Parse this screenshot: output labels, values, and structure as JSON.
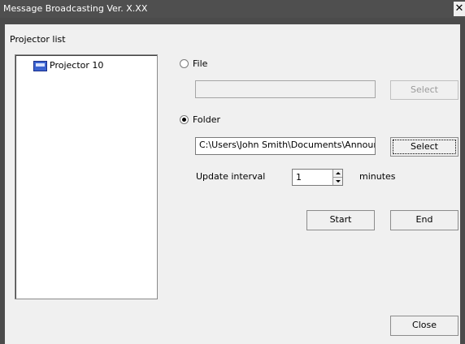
{
  "window": {
    "title": "Message Broadcasting Ver. X.XX",
    "close_glyph": "✕"
  },
  "projector_list": {
    "label": "Projector list",
    "items": [
      {
        "label": "Projector 10",
        "icon": "projector-icon"
      }
    ]
  },
  "source": {
    "file_label": "File",
    "file_path": "",
    "file_selected": false,
    "folder_label": "Folder",
    "folder_path": "C:\\Users\\John Smith\\Documents\\Announce",
    "folder_selected": true,
    "select_label": "Select"
  },
  "update_interval": {
    "label": "Update interval",
    "value": "1",
    "unit": "minutes"
  },
  "buttons": {
    "start": "Start",
    "end": "End",
    "close": "Close"
  },
  "colors": {
    "titlebar": "#4f4f4f",
    "dialog_bg": "#f0f0f0",
    "list_icon": "#3b63d0"
  }
}
